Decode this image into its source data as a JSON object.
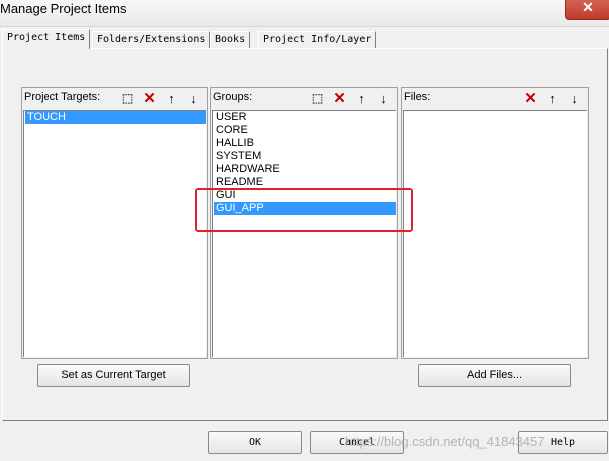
{
  "window": {
    "title": "Manage Project Items",
    "close_symbol": "✕"
  },
  "tabs": [
    "Project Items",
    "Folders/Extensions",
    "Books",
    "Project Info/Layer"
  ],
  "targets": {
    "label": "Project Targets:",
    "items": [
      {
        "text": "TOUCH",
        "selected": true
      }
    ],
    "button_label": "Set as Current Target"
  },
  "groups": {
    "label": "Groups:",
    "items": [
      {
        "text": "USER",
        "selected": false
      },
      {
        "text": "CORE",
        "selected": false
      },
      {
        "text": "HALLIB",
        "selected": false
      },
      {
        "text": "SYSTEM",
        "selected": false
      },
      {
        "text": "HARDWARE",
        "selected": false
      },
      {
        "text": "README",
        "selected": false
      },
      {
        "text": "GUI",
        "selected": false
      },
      {
        "text": "GUI_APP",
        "selected": true
      }
    ]
  },
  "files": {
    "label": "Files:",
    "items": [],
    "button_label": "Add Files..."
  },
  "toolbar_icons": {
    "new": "new-icon",
    "delete": "delete-icon",
    "up": "arrow-up-icon",
    "down": "arrow-down-icon"
  },
  "footer": {
    "ok": "OK",
    "cancel": "Cancel",
    "help": "Help"
  },
  "watermark": "https://blog.csdn.net/qq_41843457",
  "colors": {
    "selection": "#3399ff",
    "highlight_box": "#e0202a"
  }
}
